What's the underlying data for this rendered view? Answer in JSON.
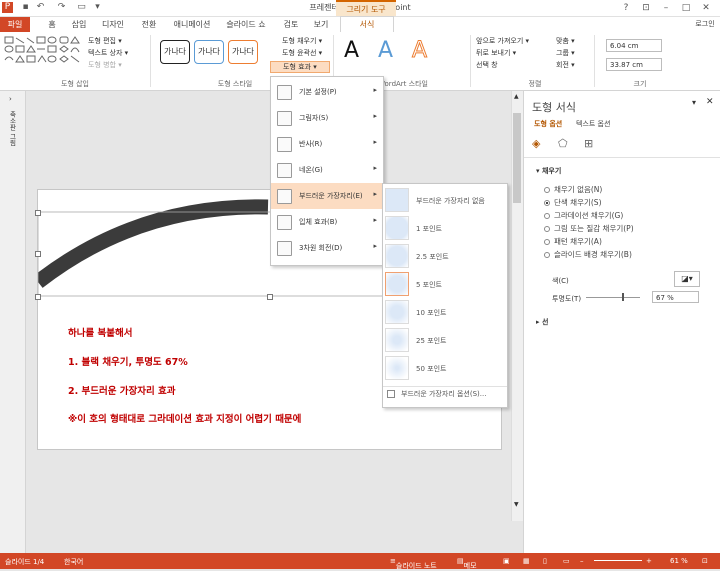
{
  "window": {
    "title": "프레젠테이션2 - PowerPoint",
    "context_tab_title": "그리기 도구",
    "help": "?",
    "signin": "로그인"
  },
  "tabs": [
    {
      "label": "파일"
    },
    {
      "label": "홈"
    },
    {
      "label": "삽입"
    },
    {
      "label": "디자인"
    },
    {
      "label": "전환"
    },
    {
      "label": "애니메이션"
    },
    {
      "label": "슬라이드 쇼"
    },
    {
      "label": "검토"
    },
    {
      "label": "보기"
    },
    {
      "label": "서식"
    }
  ],
  "ribbon": {
    "insert_shapes": {
      "label": "도형 삽입",
      "edit_shape": "도형 편집 ▾",
      "text_box": "텍스트 상자 ▾",
      "merge_shapes": "도형 병합 ▾"
    },
    "shape_styles": {
      "label": "도형 스타일",
      "style_sample": "가나다",
      "fill": "도형 채우기 ▾",
      "outline": "도형 윤곽선 ▾",
      "effects": "도형 효과 ▾"
    },
    "wordart": {
      "label": "WordArt 스타일",
      "letter": "A"
    },
    "arrange": {
      "label": "정렬",
      "bring_forward": "앞으로 가져오기 ▾",
      "send_backward": "뒤로 보내기 ▾",
      "selection_pane": "선택 창",
      "align": "맞춤 ▾",
      "group": "그룹 ▾",
      "rotate": "회전 ▾"
    },
    "size": {
      "label": "크기",
      "height": "6.04 cm",
      "width": "33.87 cm"
    }
  },
  "effects_menu": {
    "items": [
      {
        "label": "기본 설정(P)"
      },
      {
        "label": "그림자(S)"
      },
      {
        "label": "반사(R)"
      },
      {
        "label": "네온(G)"
      },
      {
        "label": "부드러운 가장자리(E)"
      },
      {
        "label": "입체 효과(B)"
      },
      {
        "label": "3차원 회전(D)"
      }
    ]
  },
  "soft_edges_menu": {
    "items": [
      {
        "label": "부드러운 가장자리 없음"
      },
      {
        "label": "1 포인트"
      },
      {
        "label": "2.5 포인트"
      },
      {
        "label": "5 포인트"
      },
      {
        "label": "10 포인트"
      },
      {
        "label": "25 포인트"
      },
      {
        "label": "50 포인트"
      }
    ],
    "options": "부드러운 가장자리 옵션(S)..."
  },
  "thumbnail_pane": {
    "label": "축소판 그림"
  },
  "slide": {
    "lines": [
      "하나를 복붙해서",
      "1. 블랙 채우기, 투명도 67%",
      "2. 부드러운 가장자리 효과",
      "※이 호의 형태대로 그라데이션 효과 지정이 어렵기 때문에"
    ],
    "text_color": "#C00000"
  },
  "format_pane": {
    "title": "도형 서식",
    "tab_shape": "도형 옵션",
    "tab_text": "텍스트 옵션",
    "section_fill": "채우기",
    "fill_options": [
      {
        "label": "채우기 없음(N)",
        "selected": false
      },
      {
        "label": "단색 채우기(S)",
        "selected": true
      },
      {
        "label": "그라데이션 채우기(G)",
        "selected": false
      },
      {
        "label": "그림 또는 질감 채우기(P)",
        "selected": false
      },
      {
        "label": "패턴 채우기(A)",
        "selected": false
      },
      {
        "label": "슬라이드 배경 채우기(B)",
        "selected": false
      }
    ],
    "color_label": "색(C)",
    "transparency_label": "투명도(T)",
    "transparency_value": "67 %",
    "transparency_level": 0.67,
    "section_line": "선"
  },
  "status": {
    "slide": "슬라이드 1/4",
    "language": "한국어",
    "notes": "슬라이드 노트",
    "memo": "메모",
    "zoom": "61 %"
  },
  "colors": {
    "accent": "#D24726",
    "context": "#D46500",
    "menu_highlight": "#FCDCC2"
  }
}
